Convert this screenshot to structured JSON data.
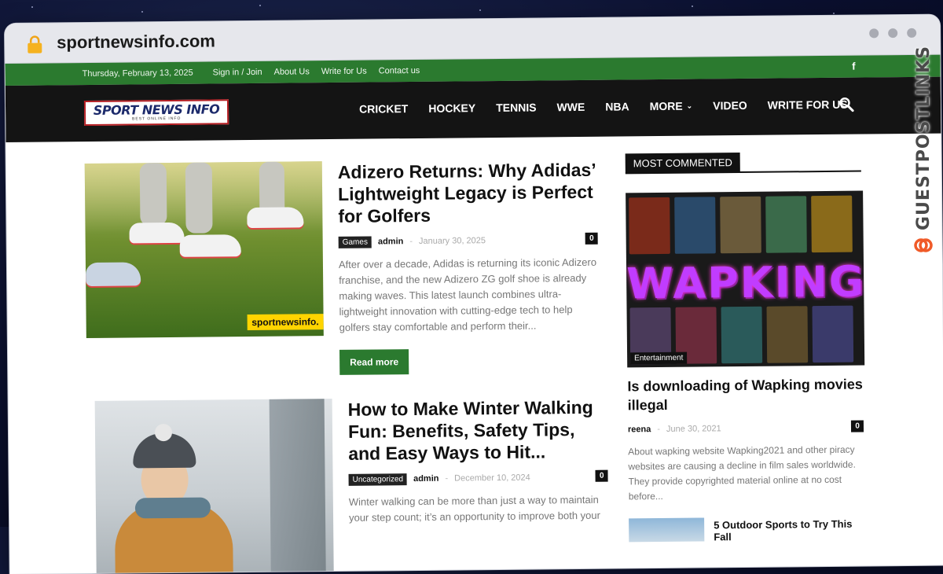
{
  "browser": {
    "url": "sportnewsinfo.com"
  },
  "topbar": {
    "date": "Thursday, February 13, 2025",
    "links": [
      "Sign in / Join",
      "About Us",
      "Write for Us",
      "Contact us"
    ],
    "social": "f"
  },
  "logo": {
    "main": "SPORT NEWS INFO",
    "sub": "BEST ONLINE INFO"
  },
  "nav": {
    "items": [
      "CRICKET",
      "HOCKEY",
      "TENNIS",
      "WWE",
      "NBA",
      "MORE",
      "VIDEO",
      "WRITE FOR US"
    ]
  },
  "articles": [
    {
      "title": "Adizero Returns: Why Adidas’ Lightweight Legacy is Perfect for Golfers",
      "tag": "Games",
      "author": "admin",
      "date": "January 30, 2025",
      "comments": "0",
      "excerpt": "After over a decade, Adidas is returning its iconic Adizero franchise, and the new Adizero ZG golf shoe is already making waves. This latest launch combines ultra-lightweight innovation with cutting-edge tech to help golfers stay comfortable and perform their...",
      "read_more": "Read more",
      "watermark": "sportnewsinfo."
    },
    {
      "title": "How to Make Winter Walking Fun: Benefits, Safety Tips, and Easy Ways to Hit...",
      "tag": "Uncategorized",
      "author": "admin",
      "date": "December 10, 2024",
      "comments": "0",
      "excerpt": "Winter walking can be more than just a way to maintain your step count; it’s an opportunity to improve both your"
    }
  ],
  "sidebar": {
    "widget_title": "MOST COMMENTED",
    "featured": {
      "image_text": "WAPKING",
      "category": "Entertainment",
      "title": "Is downloading of Wapking movies illegal",
      "author": "reena",
      "date": "June 30, 2021",
      "comments": "0",
      "excerpt": "About wapking website Wapking2021 and other piracy websites are causing a decline in film sales worldwide. They provide copyrighted material online at no cost before..."
    },
    "mini": {
      "title": "5 Outdoor Sports to Try This Fall"
    }
  },
  "badge": {
    "text": "GUESTPOSTLINKS"
  }
}
